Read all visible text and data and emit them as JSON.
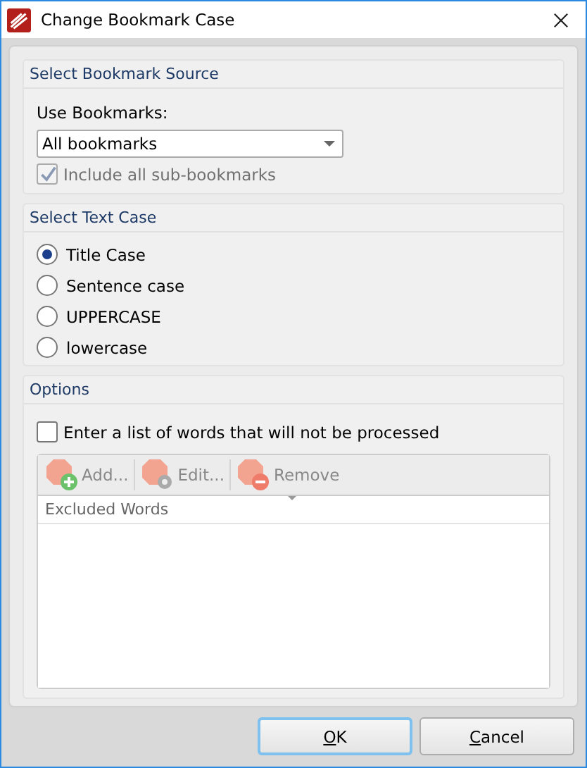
{
  "window": {
    "title": "Change Bookmark Case"
  },
  "bookmark_source": {
    "title": "Select Bookmark Source",
    "label": "Use Bookmarks:",
    "dropdown": {
      "value": "All bookmarks"
    },
    "include_sub": {
      "label": "Include all sub-bookmarks",
      "checked": true,
      "disabled": true
    }
  },
  "text_case": {
    "title": "Select Text Case",
    "options": [
      {
        "label": "Title Case",
        "selected": true
      },
      {
        "label": "Sentence case",
        "selected": false
      },
      {
        "label": "UPPERCASE",
        "selected": false
      },
      {
        "label": "lowercase",
        "selected": false
      }
    ]
  },
  "options": {
    "title": "Options",
    "exclude": {
      "label": "Enter a list of words that will not be processed",
      "checked": false
    },
    "toolbar": [
      {
        "kind": "add",
        "label": "Add...",
        "disabled": true
      },
      {
        "kind": "edit",
        "label": "Edit...",
        "disabled": true
      },
      {
        "kind": "remove",
        "label": "Remove",
        "disabled": true
      }
    ],
    "list": {
      "column": "Excluded Words"
    }
  },
  "buttons": [
    {
      "label": "OK",
      "access_key_underlined": true,
      "default": true
    },
    {
      "label": "Cancel",
      "access_key_underlined": true,
      "default": false
    }
  ]
}
